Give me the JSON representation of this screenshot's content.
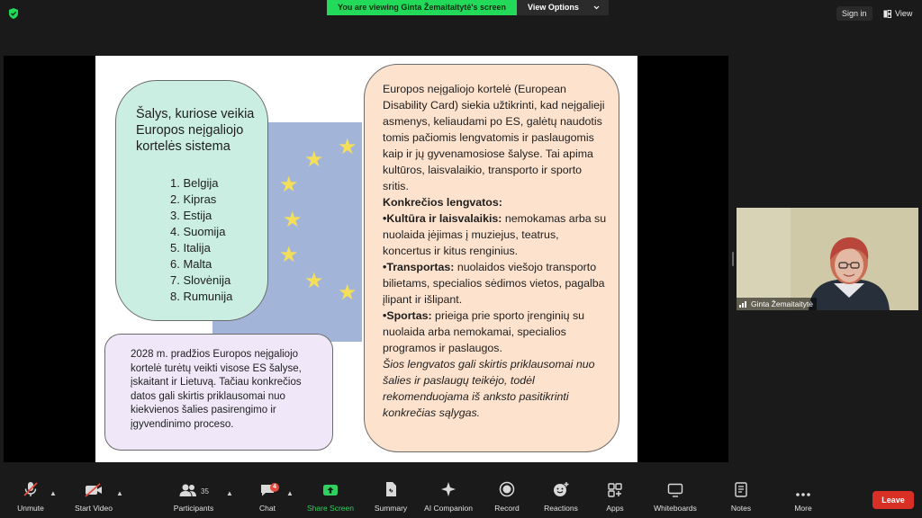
{
  "topbar": {
    "banner_text": "You are viewing Ginta Žemaitaitytė's screen",
    "view_options_label": "View Options",
    "sign_in_label": "Sign in",
    "view_label": "View"
  },
  "slide": {
    "countries_title": "Šalys, kuriose veikia Europos neįgaliojo kortelės sistema",
    "countries": [
      "1. Belgija",
      "2. Kipras",
      "3. Estija",
      "4. Suomija",
      "5. Italija",
      "6. Malta",
      "7. Slovėnija",
      "8. Rumunija"
    ],
    "year_note": "2028 m. pradžios Europos neįgaliojo kortelė turėtų veikti visose ES šalyse, įskaitant ir Lietuvą. Tačiau konkrečios datos gali skirtis priklausomai nuo kiekvienos šalies pasirengimo ir įgyvendinimo proceso.",
    "intro": "Europos neįgaliojo kortelė (European Disability Card) siekia užtikrinti, kad neįgalieji asmenys, keliaudami po ES, galėtų naudotis tomis pačiomis lengvatomis ir paslaugomis kaip ir jų gyvenamosiose šalyse. Tai apima kultūros, laisvalaikio, transporto ir sporto sritis.",
    "benefits_heading": "Konkrečios lengvatos:",
    "benefit_culture_label": "•Kultūra ir laisvalaikis:",
    "benefit_culture_text": " nemokamas arba su nuolaida įėjimas į muziejus, teatrus, koncertus ir kitus renginius.",
    "benefit_transport_label": "•Transportas:",
    "benefit_transport_text": " nuolaidos viešojo transporto bilietams, specialios sėdimos vietos, pagalba įlipant ir išlipant.",
    "benefit_sport_label": "•Sportas:",
    "benefit_sport_text": " prieiga prie sporto įrenginių su nuolaida arba nemokamai, specialios programos ir paslaugos.",
    "closing_note": "Šios lengvatos gali skirtis priklausomai nuo šalies ir paslaugų teikėjo, todėl rekomenduojama iš anksto pasitikrinti konkrečias sąlygas."
  },
  "participant": {
    "name": "Ginta Žemaitaitytė"
  },
  "toolbar": {
    "unmute": "Unmute",
    "start_video": "Start Video",
    "participants": "Participants",
    "participants_count": "35",
    "chat": "Chat",
    "chat_badge": "4",
    "share_screen": "Share Screen",
    "summary": "Summary",
    "ai_companion": "AI Companion",
    "record": "Record",
    "reactions": "Reactions",
    "apps": "Apps",
    "whiteboards": "Whiteboards",
    "notes": "Notes",
    "more": "More",
    "leave": "Leave"
  },
  "colors": {
    "banner_green": "#23d959",
    "leave_red": "#d93025",
    "share_green": "#2fd05f"
  }
}
